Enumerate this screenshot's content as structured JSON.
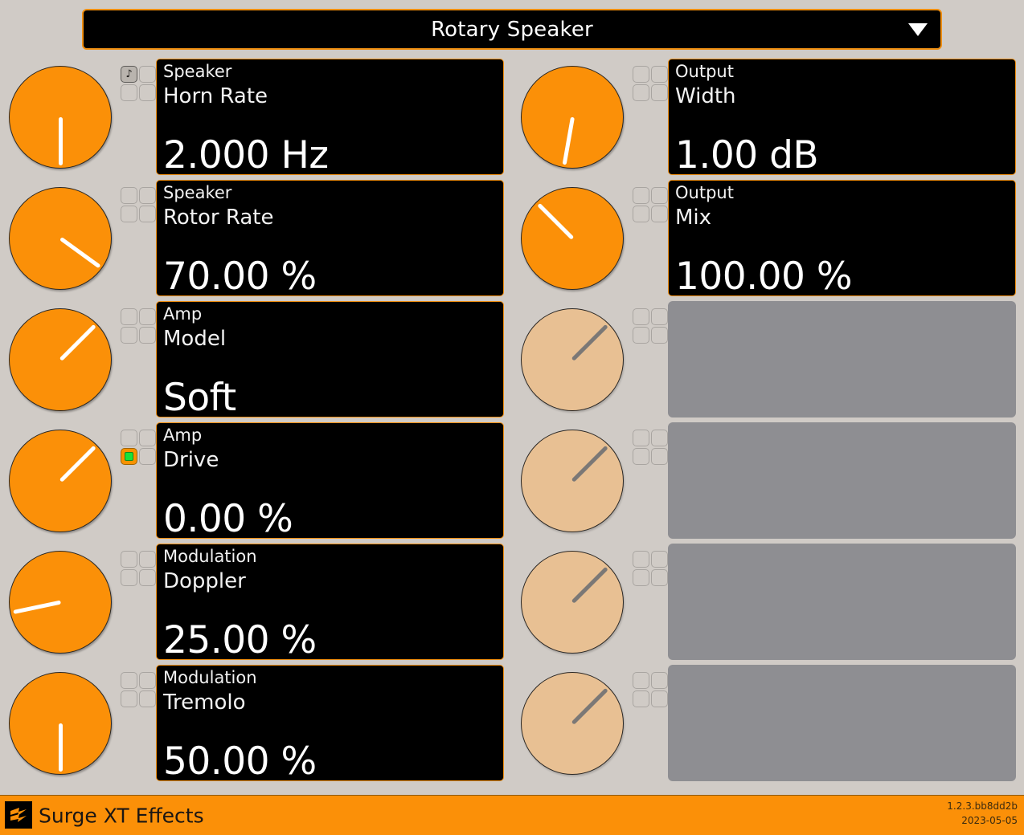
{
  "window": {
    "title": "Surge XT Effects",
    "background_color": "#d0cbc6",
    "accent_color": "#fb9008"
  },
  "header": {
    "effect_selector": {
      "name": "effect-type-selector",
      "value": "Rotary Speaker",
      "arrow_icon": "chevron-down-icon"
    }
  },
  "parameters": {
    "left_column": [
      {
        "group": "Speaker",
        "name": "Horn Rate",
        "value": "2.000 Hz",
        "enabled": true,
        "knob_angle": 180,
        "toggles": [
          {
            "icon": "tempo-sync-note-icon",
            "glyph": "♪",
            "state": "pressed"
          },
          {
            "icon": "blank-toggle-icon",
            "glyph": "",
            "state": "off"
          },
          {
            "icon": "blank-toggle-icon",
            "glyph": "",
            "state": "off"
          },
          {
            "icon": "blank-toggle-icon",
            "glyph": "",
            "state": "off"
          }
        ]
      },
      {
        "group": "Speaker",
        "name": "Rotor Rate",
        "value": "70.00 %",
        "enabled": true,
        "knob_angle": 126,
        "toggles": [
          {
            "icon": "blank-toggle-icon",
            "glyph": "",
            "state": "off"
          },
          {
            "icon": "blank-toggle-icon",
            "glyph": "",
            "state": "off"
          },
          {
            "icon": "blank-toggle-icon",
            "glyph": "",
            "state": "off"
          },
          {
            "icon": "blank-toggle-icon",
            "glyph": "",
            "state": "off"
          }
        ]
      },
      {
        "group": "Amp",
        "name": "Model",
        "value": "Soft",
        "enabled": true,
        "knob_angle": 45,
        "toggles": [
          {
            "icon": "blank-toggle-icon",
            "glyph": "",
            "state": "off"
          },
          {
            "icon": "blank-toggle-icon",
            "glyph": "",
            "state": "off"
          },
          {
            "icon": "blank-toggle-icon",
            "glyph": "",
            "state": "off"
          },
          {
            "icon": "blank-toggle-icon",
            "glyph": "",
            "state": "off"
          }
        ]
      },
      {
        "group": "Amp",
        "name": "Drive",
        "value": "0.00 %",
        "enabled": true,
        "knob_angle": 45,
        "toggles": [
          {
            "icon": "blank-toggle-icon",
            "glyph": "",
            "state": "off"
          },
          {
            "icon": "blank-toggle-icon",
            "glyph": "",
            "state": "off"
          },
          {
            "icon": "deactivate-led-icon",
            "glyph": "",
            "state": "accent"
          },
          {
            "icon": "blank-toggle-icon",
            "glyph": "",
            "state": "off"
          }
        ]
      },
      {
        "group": "Modulation",
        "name": "Doppler",
        "value": "25.00 %",
        "enabled": true,
        "knob_angle": 258,
        "toggles": [
          {
            "icon": "blank-toggle-icon",
            "glyph": "",
            "state": "off"
          },
          {
            "icon": "blank-toggle-icon",
            "glyph": "",
            "state": "off"
          },
          {
            "icon": "blank-toggle-icon",
            "glyph": "",
            "state": "off"
          },
          {
            "icon": "blank-toggle-icon",
            "glyph": "",
            "state": "off"
          }
        ]
      },
      {
        "group": "Modulation",
        "name": "Tremolo",
        "value": "50.00 %",
        "enabled": true,
        "knob_angle": 180,
        "toggles": [
          {
            "icon": "blank-toggle-icon",
            "glyph": "",
            "state": "off"
          },
          {
            "icon": "blank-toggle-icon",
            "glyph": "",
            "state": "off"
          },
          {
            "icon": "blank-toggle-icon",
            "glyph": "",
            "state": "off"
          },
          {
            "icon": "blank-toggle-icon",
            "glyph": "",
            "state": "off"
          }
        ]
      }
    ],
    "right_column": [
      {
        "group": "Output",
        "name": "Width",
        "value": "1.00 dB",
        "enabled": true,
        "knob_angle": 190,
        "toggles": [
          {
            "icon": "blank-toggle-icon",
            "glyph": "",
            "state": "off"
          },
          {
            "icon": "blank-toggle-icon",
            "glyph": "",
            "state": "off"
          },
          {
            "icon": "blank-toggle-icon",
            "glyph": "",
            "state": "off"
          },
          {
            "icon": "blank-toggle-icon",
            "glyph": "",
            "state": "off"
          }
        ]
      },
      {
        "group": "Output",
        "name": "Mix",
        "value": "100.00 %",
        "enabled": true,
        "knob_angle": 315,
        "toggles": [
          {
            "icon": "blank-toggle-icon",
            "glyph": "",
            "state": "off"
          },
          {
            "icon": "blank-toggle-icon",
            "glyph": "",
            "state": "off"
          },
          {
            "icon": "blank-toggle-icon",
            "glyph": "",
            "state": "off"
          },
          {
            "icon": "blank-toggle-icon",
            "glyph": "",
            "state": "off"
          }
        ]
      },
      {
        "group": "",
        "name": "",
        "value": "",
        "enabled": false,
        "knob_angle": 45,
        "toggles": [
          {
            "icon": "blank-toggle-icon",
            "glyph": "",
            "state": "off"
          },
          {
            "icon": "blank-toggle-icon",
            "glyph": "",
            "state": "off"
          },
          {
            "icon": "blank-toggle-icon",
            "glyph": "",
            "state": "off"
          },
          {
            "icon": "blank-toggle-icon",
            "glyph": "",
            "state": "off"
          }
        ]
      },
      {
        "group": "",
        "name": "",
        "value": "",
        "enabled": false,
        "knob_angle": 45,
        "toggles": [
          {
            "icon": "blank-toggle-icon",
            "glyph": "",
            "state": "off"
          },
          {
            "icon": "blank-toggle-icon",
            "glyph": "",
            "state": "off"
          },
          {
            "icon": "blank-toggle-icon",
            "glyph": "",
            "state": "off"
          },
          {
            "icon": "blank-toggle-icon",
            "glyph": "",
            "state": "off"
          }
        ]
      },
      {
        "group": "",
        "name": "",
        "value": "",
        "enabled": false,
        "knob_angle": 45,
        "toggles": [
          {
            "icon": "blank-toggle-icon",
            "glyph": "",
            "state": "off"
          },
          {
            "icon": "blank-toggle-icon",
            "glyph": "",
            "state": "off"
          },
          {
            "icon": "blank-toggle-icon",
            "glyph": "",
            "state": "off"
          },
          {
            "icon": "blank-toggle-icon",
            "glyph": "",
            "state": "off"
          }
        ]
      },
      {
        "group": "",
        "name": "",
        "value": "",
        "enabled": false,
        "knob_angle": 45,
        "toggles": [
          {
            "icon": "blank-toggle-icon",
            "glyph": "",
            "state": "off"
          },
          {
            "icon": "blank-toggle-icon",
            "glyph": "",
            "state": "off"
          },
          {
            "icon": "blank-toggle-icon",
            "glyph": "",
            "state": "off"
          },
          {
            "icon": "blank-toggle-icon",
            "glyph": "",
            "state": "off"
          }
        ]
      }
    ]
  },
  "footer": {
    "logo_icon": "surge-lightning-logo-icon",
    "title": "Surge XT Effects",
    "version": "1.2.3.bb8dd2b",
    "date": "2023-05-05"
  }
}
